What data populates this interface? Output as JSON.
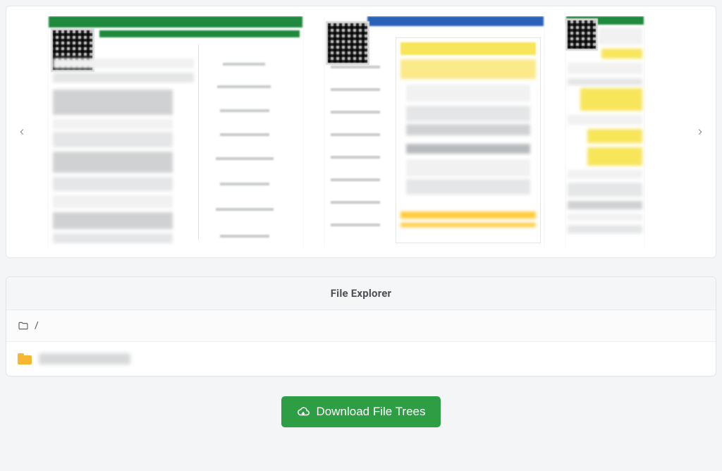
{
  "carousel": {
    "left_arrow": "‹",
    "right_arrow": "›"
  },
  "explorer": {
    "title": "File Explorer",
    "root": "/",
    "items": [
      {
        "type": "folder"
      }
    ]
  },
  "download_button_label": "Download File Trees"
}
